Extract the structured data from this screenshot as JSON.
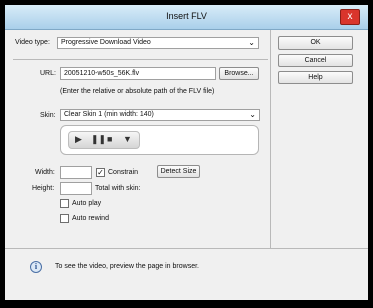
{
  "window": {
    "title": "Insert FLV",
    "close_label": "x"
  },
  "video_type": {
    "label": "Video type:",
    "value": "Progressive Download Video"
  },
  "url": {
    "label": "URL:",
    "value": "20051210-w50s_56K.flv",
    "browse": "Browse...",
    "hint": "(Enter the relative or absolute path of the FLV file)"
  },
  "skin": {
    "label": "Skin:",
    "value": "Clear Skin 1 (min width: 140)"
  },
  "size": {
    "width_label": "Width:",
    "width_value": "",
    "constrain_label": "Constrain",
    "constrain_checked": true,
    "detect_size": "Detect Size",
    "height_label": "Height:",
    "height_value": "",
    "total_label": "Total with skin:"
  },
  "options": {
    "auto_play": "Auto play",
    "auto_rewind": "Auto rewind"
  },
  "buttons": {
    "ok": "OK",
    "cancel": "Cancel",
    "help": "Help"
  },
  "footer": {
    "info_icon": "i",
    "text": "To see the video, preview the page in browser."
  }
}
